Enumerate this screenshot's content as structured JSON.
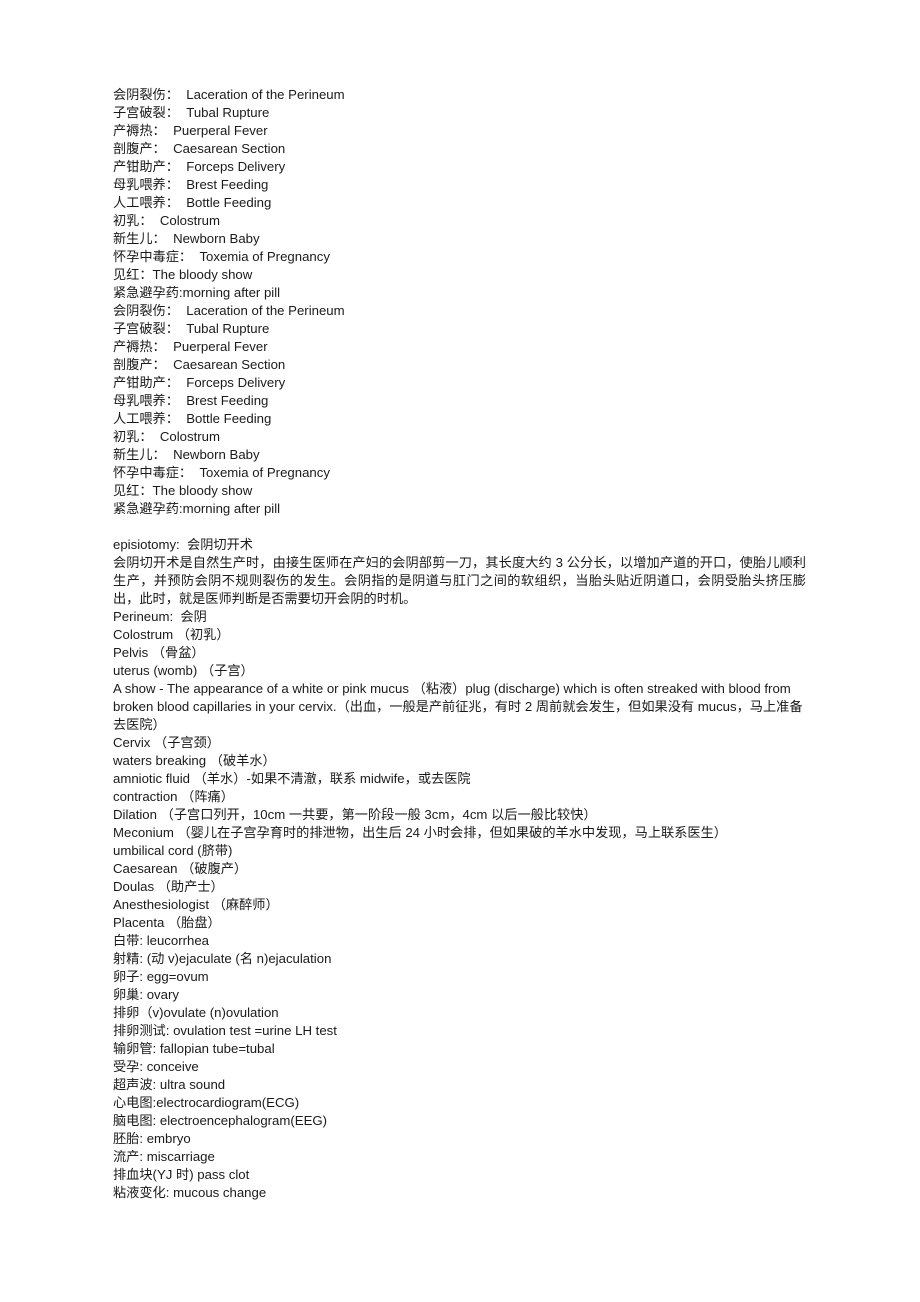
{
  "document": {
    "glossary_block_1": [
      "会阴裂伤：  Laceration of the Perineum",
      "子宫破裂：  Tubal Rupture",
      "产褥热：  Puerperal Fever",
      "剖腹产：  Caesarean Section",
      "产钳助产：  Forceps Delivery",
      "母乳喂养：  Brest Feeding",
      "人工喂养：  Bottle Feeding",
      "初乳：  Colostrum",
      "新生儿：  Newborn Baby",
      "怀孕中毒症：  Toxemia of Pregnancy",
      "见红：The bloody show",
      "紧急避孕药:morning after pill"
    ],
    "glossary_block_2": [
      "会阴裂伤：  Laceration of the Perineum",
      "子宫破裂：  Tubal Rupture",
      "产褥热：  Puerperal Fever",
      "剖腹产：  Caesarean Section",
      "产钳助产：  Forceps Delivery",
      "母乳喂养：  Brest Feeding",
      "人工喂养：  Bottle Feeding",
      "初乳：  Colostrum",
      "新生儿：  Newborn Baby",
      "怀孕中毒症：  Toxemia of Pregnancy",
      "见红：The bloody show",
      "紧急避孕药:morning after pill"
    ],
    "episiotomy_heading": "episiotomy:  会阴切开术",
    "episiotomy_paragraph": "会阴切开术是自然生产时，由接生医师在产妇的会阴部剪一刀，其长度大约 3 公分长，以增加产道的开口，使胎儿顺利生产，并预防会阴不规则裂伤的发生。会阴指的是阴道与肛门之间的软组织，当胎头贴近阴道口，会阴受胎头挤压膨出，此时，就是医师判断是否需要切开会阴的时机。",
    "terms_section": [
      "Perineum:  会阴",
      "Colostrum （初乳）",
      "Pelvis （骨盆）",
      "uterus (womb) （子宫）",
      "A show - The appearance of a white or pink mucus （粘液）plug (discharge) which is often streaked with blood from broken blood capillaries in your cervix.（出血，一般是产前征兆，有时 2 周前就会发生，但如果没有 mucus，马上准备去医院）",
      "Cervix （子宫颈）",
      "waters breaking （破羊水）",
      "amniotic fluid （羊水）-如果不清澈，联系 midwife，或去医院",
      "contraction （阵痛）",
      "Dilation （子宫口列开，10cm 一共要，第一阶段一般 3cm，4cm 以后一般比较快）",
      "Meconium （婴儿在子宫孕育时的排泄物，出生后 24 小时会排，但如果破的羊水中发现，马上联系医生）",
      "umbilical cord (脐带)",
      "Caesarean （破腹产）",
      "Doulas （助产士）",
      "Anesthesiologist （麻醉师）",
      "Placenta （胎盘）",
      "白带: leucorrhea",
      "射精: (动 v)ejaculate (名 n)ejaculation",
      "卵子: egg=ovum",
      "卵巢: ovary",
      "排卵（v)ovulate (n)ovulation",
      "排卵测试: ovulation test =urine LH test",
      "输卵管: fallopian tube=tubal",
      "受孕: conceive",
      "超声波: ultra sound",
      "心电图:electrocardiogram(ECG)",
      "脑电图: electroencephalogram(EEG)",
      "胚胎: embryo",
      "流产: miscarriage",
      "排血块(YJ 时) pass clot",
      "粘液变化: mucous change"
    ]
  }
}
